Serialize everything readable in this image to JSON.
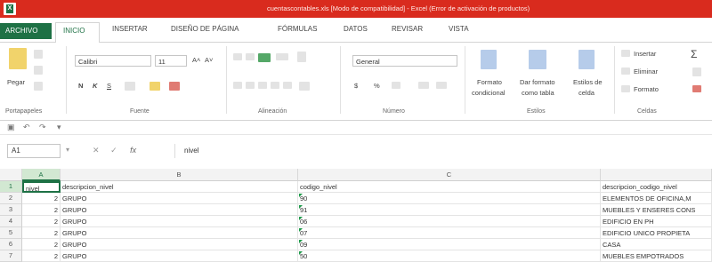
{
  "window": {
    "title": "cuentascontables.xls [Modo de compatibilidad] - Excel (Error de activación de productos)"
  },
  "tabs": [
    {
      "label": "ARCHIVO"
    },
    {
      "label": "INICIO"
    },
    {
      "label": "INSERTAR"
    },
    {
      "label": "DISEÑO DE PÁGINA"
    },
    {
      "label": "FÓRMULAS"
    },
    {
      "label": "DATOS"
    },
    {
      "label": "REVISAR"
    },
    {
      "label": "VISTA"
    }
  ],
  "ribbon": {
    "clipboard": {
      "paste_label": "Pegar",
      "group_label": "Portapapeles"
    },
    "font": {
      "name": "Calibri",
      "size": "11",
      "bold": "N",
      "italic": "K",
      "underline": "S",
      "group_label": "Fuente"
    },
    "alignment": {
      "group_label": "Alineación"
    },
    "number": {
      "format": "General",
      "currency": "$",
      "percent": "%",
      "group_label": "Número"
    },
    "styles": {
      "conditional_label_1": "Formato",
      "conditional_label_2": "condicional",
      "table_label_1": "Dar formato",
      "table_label_2": "como tabla",
      "cell_styles_1": "Estilos de",
      "cell_styles_2": "celda",
      "group_label": "Estilos"
    },
    "cells": {
      "insert": "Insertar",
      "delete": "Eliminar",
      "format": "Formato",
      "group_label": "Celdas"
    }
  },
  "formula_bar": {
    "name_box": "A1",
    "formula": "nivel"
  },
  "columns": [
    "A",
    "B",
    "C"
  ],
  "rows": [
    {
      "num": "1",
      "a": "nivel",
      "b": "descripcion_nivel",
      "c": "codigo_nivel",
      "d": "descripcion_codigo_nivel"
    },
    {
      "num": "2",
      "a": "2",
      "b": "GRUPO",
      "c": "90",
      "d": "ELEMENTOS DE OFICINA,M"
    },
    {
      "num": "3",
      "a": "2",
      "b": "GRUPO",
      "c": "91",
      "d": "MUEBLES Y ENSERES CONS"
    },
    {
      "num": "4",
      "a": "2",
      "b": "GRUPO",
      "c": "06",
      "d": "EDIFICIO EN PH"
    },
    {
      "num": "5",
      "a": "2",
      "b": "GRUPO",
      "c": "07",
      "d": "EDIFICIO UNICO PROPIETA"
    },
    {
      "num": "6",
      "a": "2",
      "b": "GRUPO",
      "c": "09",
      "d": "CASA"
    },
    {
      "num": "7",
      "a": "2",
      "b": "GRUPO",
      "c": "50",
      "d": "MUEBLES EMPOTRADOS"
    }
  ]
}
